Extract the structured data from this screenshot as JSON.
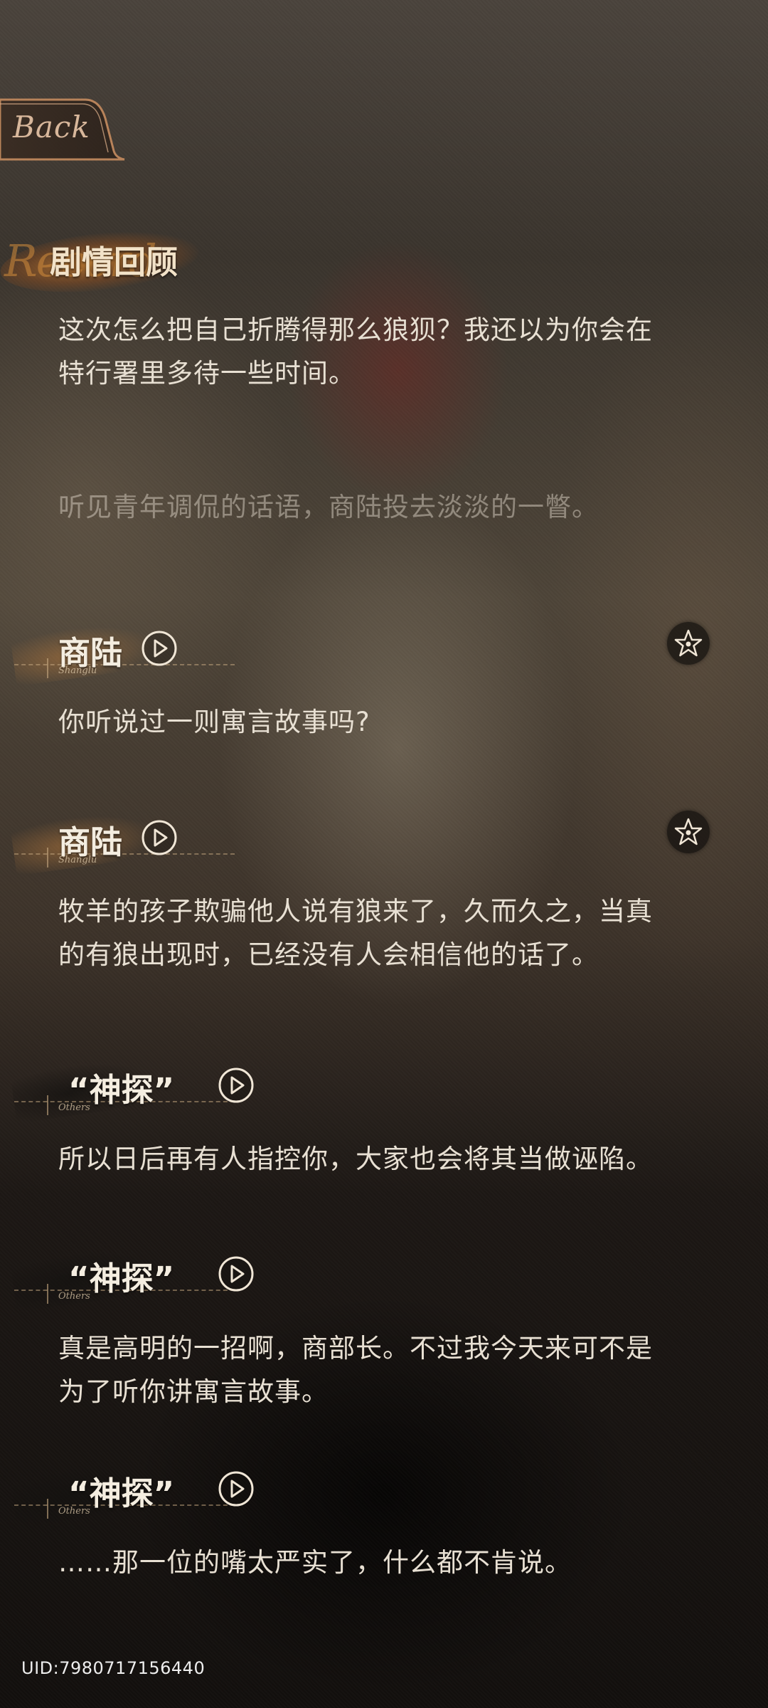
{
  "header": {
    "back_label": "Back",
    "title": "剧情回顾",
    "title_script": "Record"
  },
  "dialogue": {
    "partial_line_1": "这次怎么把自己折腾得那么狼狈？我还以为你会在",
    "partial_line_2": "特行署里多待一些时间。",
    "narration": "听见青年调侃的话语，商陆投去淡淡的一瞥。",
    "entries": [
      {
        "speaker": "商陆",
        "speaker_sub": "Shanglu",
        "text": "你听说过一则寓言故事吗?"
      },
      {
        "speaker": "商陆",
        "speaker_sub": "Shanglu",
        "text_lines": [
          "牧羊的孩子欺骗他人说有狼来了，久而久之，当真",
          "的有狼出现时，已经没有人会相信他的话了。"
        ]
      },
      {
        "speaker": "“神探”",
        "speaker_sub": "Others",
        "text": "所以日后再有人指控你，大家也会将其当做诬陷。"
      },
      {
        "speaker": "“神探”",
        "speaker_sub": "Others",
        "text_lines": [
          "真是高明的一招啊，商部长。不过我今天来可不是",
          "为了听你讲寓言故事。"
        ]
      },
      {
        "speaker": "“神探”",
        "speaker_sub": "Others",
        "text": "……那一位的嘴太严实了，什么都不肯说。"
      }
    ]
  },
  "footer": {
    "uid": "UID:7980717156440"
  },
  "icons": {
    "play": "play-voice-icon",
    "star": "favorite-star-icon",
    "back": "back-arrow-icon"
  },
  "colors": {
    "accent_gold": "#c47c30",
    "text_light": "#e8e0d3"
  }
}
